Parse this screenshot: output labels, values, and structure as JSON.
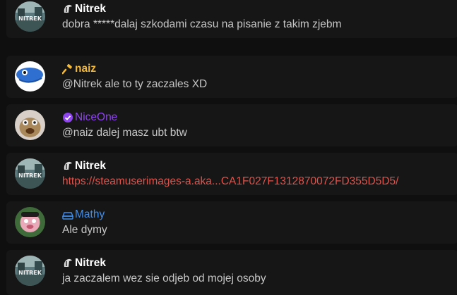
{
  "colors": {
    "background": "#0f0f0f",
    "card": "#161616",
    "nitrek": "#ffffff",
    "naiz": "#f2b93b",
    "niceone": "#8e44ef",
    "mathy": "#3d8ef0",
    "text": "#c7c7c7",
    "link": "#e0524a"
  },
  "messages": [
    {
      "author": "Nitrek",
      "badge": "spartan-helmet-icon",
      "text": "dobra *****dalaj szkodami czasu na pisanie z takim zjebm"
    },
    {
      "author": "naiz",
      "badge": "hammer-icon",
      "text": "@Nitrek ale to ty zaczales XD"
    },
    {
      "author": "NiceOne",
      "badge": "verified-check-icon",
      "text": "@naiz dalej masz ubt btw"
    },
    {
      "author": "Nitrek",
      "badge": "spartan-helmet-icon",
      "text": "https://steamuserimages-a.aka...CA1F027F1312870072FD355D5D5/"
    },
    {
      "author": "Mathy",
      "badge": "drive-icon",
      "text": "Ale dymy"
    },
    {
      "author": "Nitrek",
      "badge": "spartan-helmet-icon",
      "text": "ja zaczalem wez sie odjeb od mojej osoby"
    }
  ]
}
